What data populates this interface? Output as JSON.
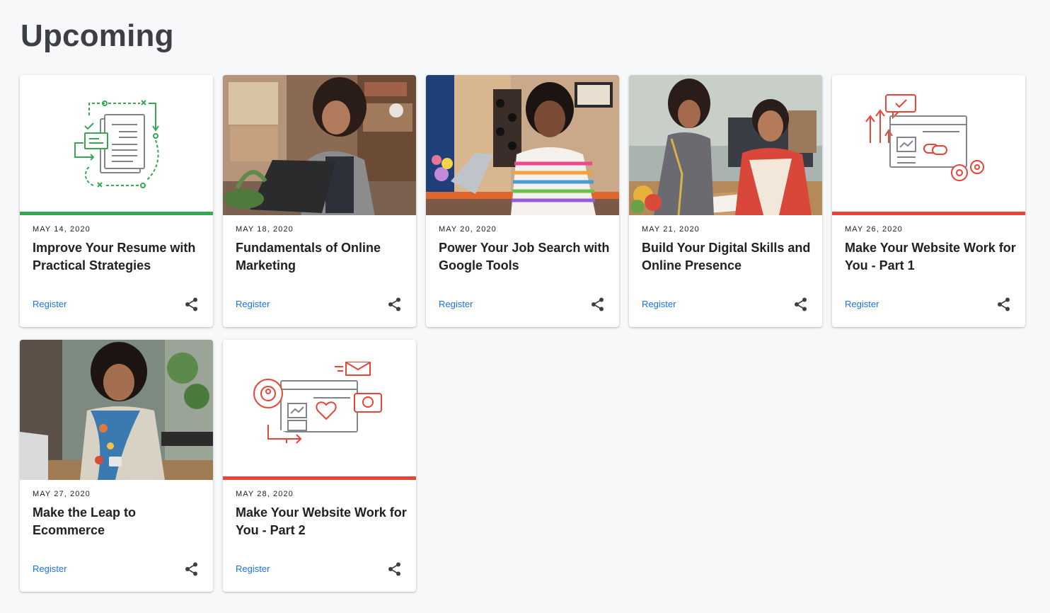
{
  "section": {
    "title": "Upcoming"
  },
  "colors": {
    "green_accent": "#34a853",
    "red_accent": "#ea4335",
    "link_blue": "#1a73e8"
  },
  "cards": [
    {
      "date": "MAY 14, 2020",
      "title": "Improve Your Resume with Practical Strategies",
      "register": "Register",
      "media": "resume-illustration",
      "accent": "green"
    },
    {
      "date": "MAY 18, 2020",
      "title": "Fundamentals of Online Marketing",
      "register": "Register",
      "media": "photo-woman-laptop",
      "accent": "none"
    },
    {
      "date": "MAY 20, 2020",
      "title": "Power Your Job Search with Google Tools",
      "register": "Register",
      "media": "photo-woman-smiling-striped-shirt",
      "accent": "none"
    },
    {
      "date": "MAY 21, 2020",
      "title": "Build Your Digital Skills and Online Presence",
      "register": "Register",
      "media": "photo-two-women-office",
      "accent": "none"
    },
    {
      "date": "MAY 26, 2020",
      "title": "Make Your Website Work for You - Part 1",
      "register": "Register",
      "media": "website-illustration",
      "accent": "red"
    },
    {
      "date": "MAY 27, 2020",
      "title": "Make the Leap to Ecommerce",
      "register": "Register",
      "media": "photo-woman-phone-scarf",
      "accent": "none"
    },
    {
      "date": "MAY 28, 2020",
      "title": "Make Your Website Work for You - Part 2",
      "register": "Register",
      "media": "website-illustration-2",
      "accent": "red"
    }
  ]
}
